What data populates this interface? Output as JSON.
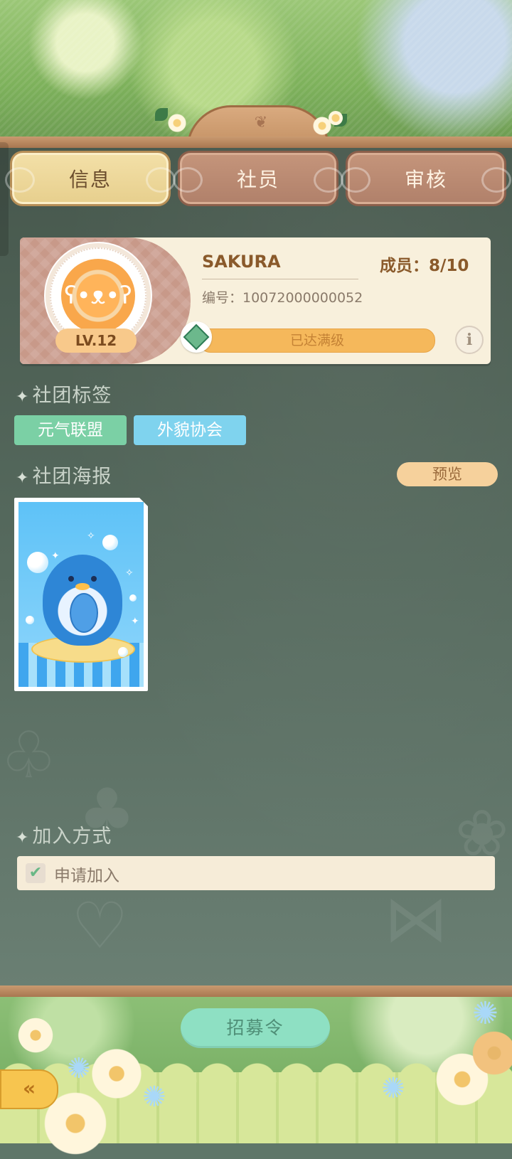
{
  "tabs": [
    {
      "label": "信息",
      "active": true
    },
    {
      "label": "社员",
      "active": false
    },
    {
      "label": "审核",
      "active": false
    }
  ],
  "club": {
    "name": "SAKURA",
    "members_label": "成员：8/10",
    "id_label": "编号：10072000000052",
    "level": "LV.12",
    "level_status": "已达满级",
    "level_progress": 1.0,
    "info_icon_text": "i"
  },
  "sections": {
    "tags_title": "社团标签",
    "poster_title": "社团海报",
    "join_title": "加入方式"
  },
  "tags": [
    {
      "label": "元气联盟",
      "color": "#7bd0a5"
    },
    {
      "label": "外貌协会",
      "color": "#7fd3ee"
    }
  ],
  "preview_label": "预览",
  "join": {
    "option_label": "申请加入",
    "checked": true,
    "check_glyph": "✔"
  },
  "bottom": {
    "recruit_label": "招募令",
    "back_icon": "back-arrow-icon"
  },
  "colors": {
    "board": "#566a5e",
    "tab_active": "#f3e0a8",
    "tab_inactive": "#c5957b",
    "progress": "#f5b85b",
    "recruit_button": "#8ee0c3",
    "back_button": "#f7c54f"
  }
}
